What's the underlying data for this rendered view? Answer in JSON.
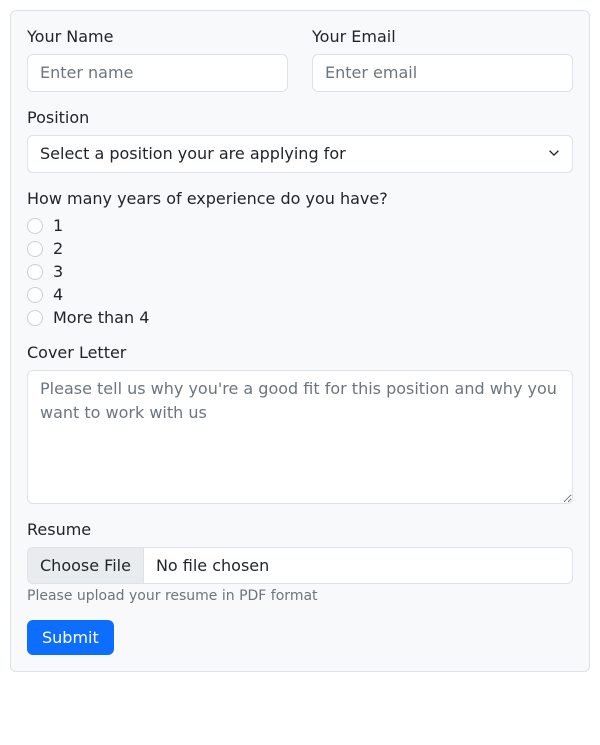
{
  "name": {
    "label": "Your Name",
    "placeholder": "Enter name",
    "value": ""
  },
  "email": {
    "label": "Your Email",
    "placeholder": "Enter email",
    "value": ""
  },
  "position": {
    "label": "Position",
    "selected": "Select a position your are applying for"
  },
  "experience": {
    "label": "How many years of experience do you have?",
    "options": [
      "1",
      "2",
      "3",
      "4",
      "More than 4"
    ]
  },
  "cover_letter": {
    "label": "Cover Letter",
    "placeholder": "Please tell us why you're a good fit for this position and why you want to work with us",
    "value": ""
  },
  "resume": {
    "label": "Resume",
    "button": "Choose File",
    "status": "No file chosen",
    "help": "Please upload your resume in PDF format"
  },
  "submit_label": "Submit"
}
